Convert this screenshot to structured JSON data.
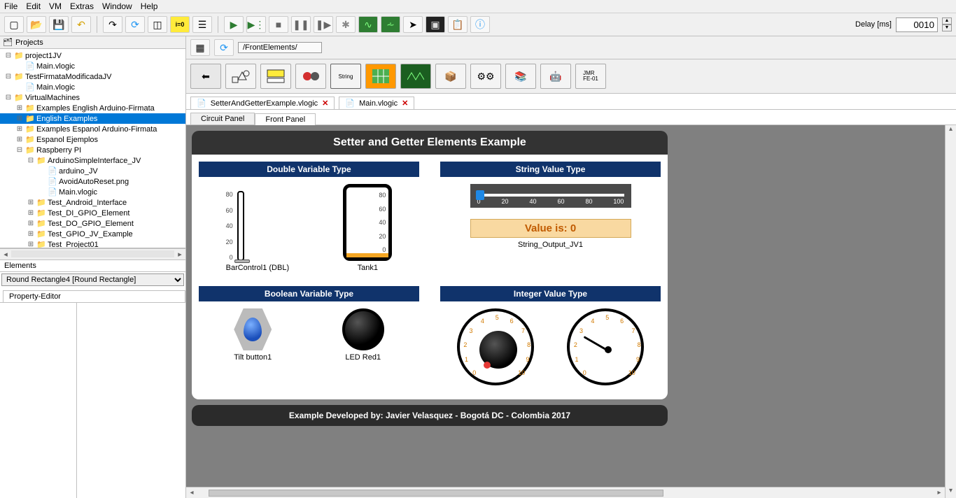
{
  "menu": {
    "items": [
      "File",
      "Edit",
      "VM",
      "Extras",
      "Window",
      "Help"
    ]
  },
  "delay": {
    "label": "Delay [ms]",
    "value": "0010"
  },
  "tree": {
    "title": "Projects",
    "items": [
      {
        "indent": 0,
        "twist": "⊟",
        "icon": "📁",
        "label": "project1JV"
      },
      {
        "indent": 1,
        "twist": "",
        "icon": "📄",
        "label": "Main.vlogic"
      },
      {
        "indent": 0,
        "twist": "⊟",
        "icon": "📁",
        "label": "TestFirmataModificadaJV"
      },
      {
        "indent": 1,
        "twist": "",
        "icon": "📄",
        "label": "Main.vlogic"
      },
      {
        "indent": 0,
        "twist": "⊟",
        "icon": "📁",
        "label": "VirtualMachines"
      },
      {
        "indent": 1,
        "twist": "⊞",
        "icon": "📁",
        "label": "Examples English Arduino-Firmata"
      },
      {
        "indent": 1,
        "twist": "⊞",
        "icon": "📁",
        "label": "English Examples",
        "selected": true
      },
      {
        "indent": 1,
        "twist": "⊞",
        "icon": "📁",
        "label": "Examples Espanol Arduino-Firmata"
      },
      {
        "indent": 1,
        "twist": "⊞",
        "icon": "📁",
        "label": "Espanol Ejemplos"
      },
      {
        "indent": 1,
        "twist": "⊟",
        "icon": "📁",
        "label": "Raspberry PI"
      },
      {
        "indent": 2,
        "twist": "⊟",
        "icon": "📁",
        "label": "ArduinoSimpleInterface_JV"
      },
      {
        "indent": 3,
        "twist": "",
        "icon": "📄",
        "label": "arduino_JV"
      },
      {
        "indent": 3,
        "twist": "",
        "icon": "📄",
        "label": "AvoidAutoReset.png"
      },
      {
        "indent": 3,
        "twist": "",
        "icon": "📄",
        "label": "Main.vlogic"
      },
      {
        "indent": 2,
        "twist": "⊞",
        "icon": "📁",
        "label": "Test_Android_Interface"
      },
      {
        "indent": 2,
        "twist": "⊞",
        "icon": "📁",
        "label": "Test_DI_GPIO_Element"
      },
      {
        "indent": 2,
        "twist": "⊞",
        "icon": "📁",
        "label": "Test_DO_GPIO_Element"
      },
      {
        "indent": 2,
        "twist": "⊞",
        "icon": "📁",
        "label": "Test_GPIO_JV_Example"
      },
      {
        "indent": 2,
        "twist": "⊞",
        "icon": "📁",
        "label": "Test_Project01"
      }
    ]
  },
  "elements": {
    "title": "Elements",
    "selected": "Round Rectangle4 [Round Rectangle]"
  },
  "property_tab": "Property-Editor",
  "breadcrumb": "/FrontElements/",
  "palette": {
    "jmr": "JMR\nFE-01"
  },
  "file_tabs": [
    {
      "label": "SetterAndGetterExample.vlogic",
      "icon": "📄"
    },
    {
      "label": "Main.vlogic",
      "icon": "📄"
    }
  ],
  "panel_tabs": {
    "circuit": "Circuit Panel",
    "front": "Front Panel"
  },
  "panel": {
    "title": "Setter and Getter Elements Example",
    "s1_head": "Double Variable Type",
    "s2_head": "String Value Type",
    "s3_head": "Boolean Variable Type",
    "s4_head": "Integer Value Type",
    "bar_label": "BarControl1 (DBL)",
    "bar_ticks": [
      "80",
      "60",
      "40",
      "20",
      "0"
    ],
    "tank_label": "Tank1",
    "tank_ticks": [
      "80",
      "60",
      "40",
      "20",
      "0"
    ],
    "slider_ticks": [
      "0",
      "20",
      "40",
      "60",
      "80",
      "100"
    ],
    "out_value": "Value is: 0",
    "out_label": "String_Output_JV1",
    "tilt_label": "Tilt button1",
    "led_label": "LED Red1",
    "dial_nums": [
      "0",
      "1",
      "2",
      "3",
      "4",
      "5",
      "6",
      "7",
      "8",
      "9",
      "10"
    ],
    "footer": "Example Developed by: Javier Velasquez - Bogotá DC - Colombia 2017"
  }
}
